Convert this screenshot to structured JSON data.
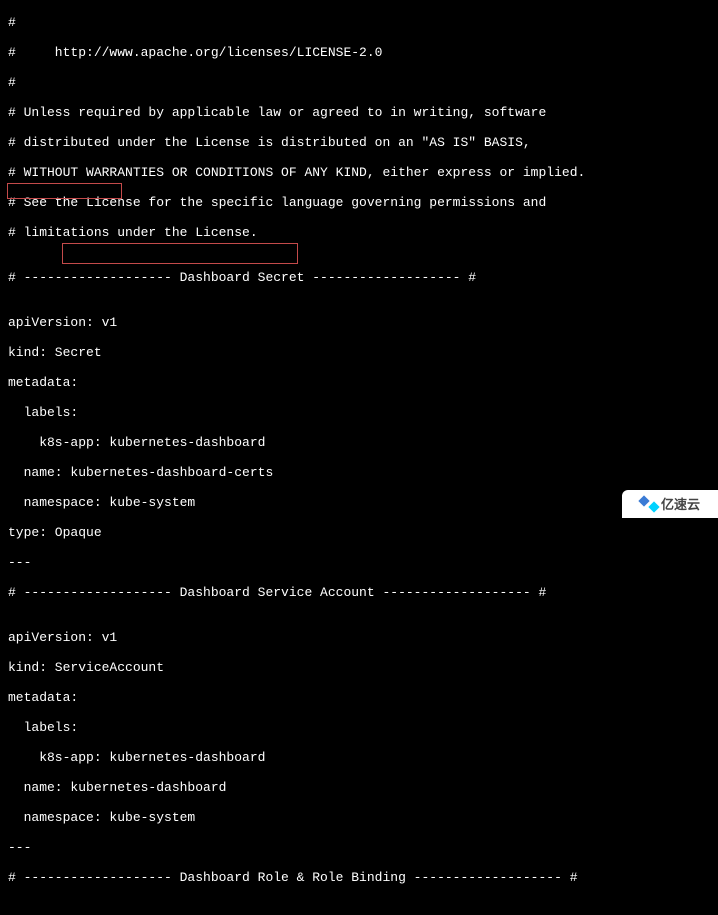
{
  "lines": {
    "l0": "#",
    "l1": "#     http://www.apache.org/licenses/LICENSE-2.0",
    "l2": "#",
    "l3": "# Unless required by applicable law or agreed to in writing, software",
    "l4": "# distributed under the License is distributed on an \"AS IS\" BASIS,",
    "l5": "# WITHOUT WARRANTIES OR CONDITIONS OF ANY KIND, either express or implied.",
    "l6": "# See the License for the specific language governing permissions and",
    "l7": "# limitations under the License.",
    "l8": "",
    "l9": "# ------------------- Dashboard Secret ------------------- #",
    "l10": "",
    "l11": "apiVersion: v1",
    "l12": "kind: Secret",
    "l13": "metadata:",
    "l14": "  labels:",
    "l15": "    k8s-app: kubernetes-dashboard",
    "l16": "  name: kubernetes-dashboard-certs",
    "l17": "  namespace: kube-system",
    "l18": "type: Opaque",
    "l19": "---",
    "l20": "# ------------------- Dashboard Service Account ------------------- #",
    "l21": "",
    "l22": "apiVersion: v1",
    "l23": "kind: ServiceAccount",
    "l24": "metadata:",
    "l25": "  labels:",
    "l26": "    k8s-app: kubernetes-dashboard",
    "l27": "  name: kubernetes-dashboard",
    "l28": "  namespace: kube-system",
    "l29": "---",
    "l30": "# ------------------- Dashboard Role & Role Binding ------------------- #",
    "l31": ""
  },
  "highlight1": "kind: Secret",
  "highlight2": "kubernetes-dashboard-certs",
  "watermark": "亿速云"
}
